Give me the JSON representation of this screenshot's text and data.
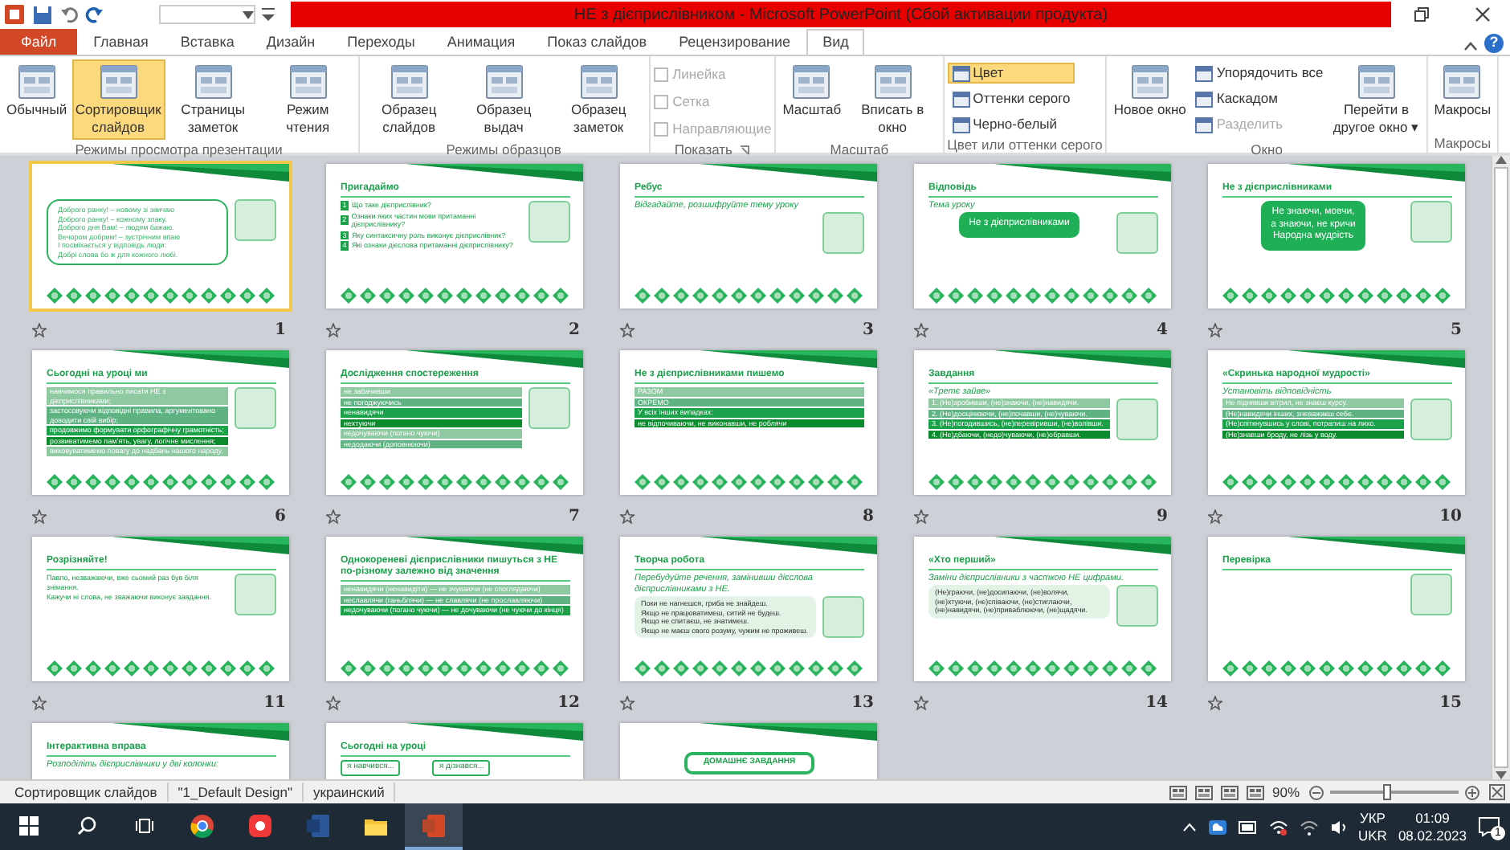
{
  "window": {
    "title": "НЕ з дієприслівником  -  Microsoft PowerPoint (Сбой активации продукта)",
    "help": "?"
  },
  "ribbon_tabs": [
    {
      "label": "Файл",
      "kind": "file",
      "selected": false
    },
    {
      "label": "Главная",
      "kind": "tab",
      "selected": false
    },
    {
      "label": "Вставка",
      "kind": "tab",
      "selected": false
    },
    {
      "label": "Дизайн",
      "kind": "tab",
      "selected": false
    },
    {
      "label": "Переходы",
      "kind": "tab",
      "selected": false
    },
    {
      "label": "Анимация",
      "kind": "tab",
      "selected": false
    },
    {
      "label": "Показ слайдов",
      "kind": "tab",
      "selected": false
    },
    {
      "label": "Рецензирование",
      "kind": "tab",
      "selected": false
    },
    {
      "label": "Вид",
      "kind": "tab",
      "selected": true
    }
  ],
  "ribbon_groups": [
    {
      "label": "Режимы просмотра презентации",
      "controls": [
        {
          "kind": "large",
          "label": "Обычный",
          "selected": false,
          "disabled": false
        },
        {
          "kind": "large",
          "label": "Сортировщик слайдов",
          "selected": true,
          "disabled": false
        },
        {
          "kind": "large",
          "label": "Страницы заметок",
          "selected": false,
          "disabled": false
        },
        {
          "kind": "large",
          "label": "Режим чтения",
          "selected": false,
          "disabled": false
        }
      ]
    },
    {
      "label": "Режимы образцов",
      "controls": [
        {
          "kind": "large",
          "label": "Образец слайдов",
          "selected": false,
          "disabled": false
        },
        {
          "kind": "large",
          "label": "Образец выдач",
          "selected": false,
          "disabled": false
        },
        {
          "kind": "large",
          "label": "Образец заметок",
          "selected": false,
          "disabled": false
        }
      ]
    },
    {
      "label": "Показать",
      "launcher": true,
      "controls": [
        {
          "kind": "check",
          "label": "Линейка",
          "checked": false,
          "disabled": true
        },
        {
          "kind": "check",
          "label": "Сетка",
          "checked": false,
          "disabled": true
        },
        {
          "kind": "check",
          "label": "Направляющие",
          "checked": false,
          "disabled": true
        }
      ]
    },
    {
      "label": "Масштаб",
      "controls": [
        {
          "kind": "large",
          "label": "Масштаб",
          "selected": false,
          "disabled": false
        },
        {
          "kind": "large",
          "label": "Вписать в окно",
          "selected": false,
          "disabled": false
        }
      ]
    },
    {
      "label": "Цвет или оттенки серого",
      "controls": [
        {
          "kind": "small",
          "label": "Цвет",
          "selected": true,
          "disabled": false
        },
        {
          "kind": "small",
          "label": "Оттенки серого",
          "selected": false,
          "disabled": false
        },
        {
          "kind": "small",
          "label": "Черно-белый",
          "selected": false,
          "disabled": false
        }
      ]
    },
    {
      "label": "Окно",
      "controls": [
        {
          "kind": "large",
          "label": "Новое окно",
          "selected": false,
          "disabled": false
        },
        {
          "kind": "small",
          "label": "Упорядочить все",
          "selected": false,
          "disabled": false
        },
        {
          "kind": "small",
          "label": "Каскадом",
          "selected": false,
          "disabled": false
        },
        {
          "kind": "small",
          "label": "Разделить",
          "selected": false,
          "disabled": true
        },
        {
          "kind": "large",
          "label": "Перейти в другое окно ▾",
          "selected": false,
          "disabled": false
        }
      ]
    },
    {
      "label": "Макросы",
      "controls": [
        {
          "kind": "large",
          "label": "Макросы",
          "selected": false,
          "disabled": false
        }
      ]
    }
  ],
  "slides": [
    {
      "number": "1",
      "selected": true,
      "kind": "outline",
      "picture": true,
      "lines": [
        "Доброго ранку! – новому зі звичаю",
        "Доброго ранку! – кожному злаку.",
        "Доброго дня Вам! – людям бажаю.",
        "Вечором добрим! – зустрічним впаю",
        "І посміхається у відповідь люди:",
        "Добрі слова бо ж для кожного любі."
      ]
    },
    {
      "number": "2",
      "selected": false,
      "title": "Пригадаймо",
      "kind": "numbered",
      "picture": true,
      "lines": [
        {
          "n": "1",
          "text": "Що таке дієприслівник?"
        },
        {
          "n": "2",
          "text": "Ознаки яких частин мови притаманні дієприслівнику?"
        },
        {
          "n": "3",
          "text": "Яку синтаксичну роль виконує дієприслівник?"
        },
        {
          "n": "4",
          "text": "Які ознаки дієслова притаманні дієприслівнику?"
        }
      ]
    },
    {
      "number": "3",
      "selected": false,
      "title": "Ребус",
      "subtitle": "Відгадайте, розшифруйте тему уроку",
      "kind": "plain",
      "picture": true
    },
    {
      "number": "4",
      "selected": false,
      "title": "Відповідь",
      "subtitle": "Тема уроку",
      "kind": "bubble",
      "picture": true,
      "lines": [
        "Не з дієприслівниками"
      ]
    },
    {
      "number": "5",
      "selected": false,
      "title": "Не з дієприслівниками",
      "kind": "bubble",
      "picture": true,
      "lines": [
        "Не знаючи, мовчи,",
        "а знаючи, не кричи",
        "Народна мудрість"
      ]
    },
    {
      "number": "6",
      "selected": false,
      "title": "Сьогодні на уроці ми",
      "kind": "boxes",
      "picture": true,
      "lines": [
        "навчимося правильно писати НЕ з дієприслівниками;",
        "застосовуючи відповідні правила, аргументовано доводити свій вибір;",
        "продовжимо формувати орфографічну грамотність;",
        "розвиватимемо пам’ять, увагу, логічне мислення;",
        "виховуватимемо повагу до надбань нашого народу."
      ]
    },
    {
      "number": "7",
      "selected": false,
      "title": "Дослідження спостереження",
      "kind": "boxes",
      "picture": true,
      "lines": [
        "не забачивши",
        "не погоджуючись",
        "ненавидячи",
        "нехтуючи",
        "недочуваючи (погано чуючи)",
        "недодаючи (доповнюючи)"
      ]
    },
    {
      "number": "8",
      "selected": false,
      "title": "Не з дієприслівниками пишемо",
      "kind": "boxes",
      "lines": [
        "РАЗОМ",
        "ОКРЕМО",
        "У всіх інших випадках:",
        "не відпочиваючи, не виконавши, не роблячи"
      ]
    },
    {
      "number": "9",
      "selected": false,
      "title": "Завдання",
      "subtitle": "«Третє зайве»",
      "kind": "boxes",
      "picture": true,
      "lines": [
        "1. (Не)зробивши, (не)знаючи, (не)навидячи.",
        "2. (Не)дооцінюючи, (не)почавши, (не)чуваючи.",
        "3. (Не)погодившись, (не)перевіривши, (не)волівши.",
        "4. (Не)дбаючи, (недо)чуваючи, (не)обравши."
      ]
    },
    {
      "number": "10",
      "selected": false,
      "title": "«Скринька народної мудрості»",
      "subtitle": "Установіть відповідність",
      "kind": "boxes",
      "picture": true,
      "lines": [
        "Не піднявши вітрил, не знаєш курсу.",
        "(Не)навидячи інших, зневажаєш себе.",
        "(Не)спіткнувшись у слові, потрапиш на лихо.",
        "(Не)знавши броду, не лізь у воду."
      ]
    },
    {
      "number": "11",
      "selected": false,
      "title": "Розрізняйте!",
      "kind": "plain",
      "picture": true,
      "lines": [
        "Павло, незважаючи, вже сьомий раз був біля знімання.",
        "Кажучи ні слова, не зважаючи виконує завдання."
      ]
    },
    {
      "number": "12",
      "selected": false,
      "title": "Однокореневі дієприслівники пишуться з НЕ по-різному залежно від значення",
      "kind": "boxes",
      "lines": [
        "ненавидячи (ненавидіти) — не зчуваючи (не споглядаючи)",
        "неславлячи (ганьблячи) — не славлячи (не прославляючи)",
        "недочуваючи (погано чуючи) — не дочуваючи (не чуючи до кінця)"
      ]
    },
    {
      "number": "13",
      "selected": false,
      "title": "Творча робота",
      "subtitle": "Перебудуйте речення, замінивши дієслова дієприслівниками з НЕ.",
      "kind": "light",
      "picture": true,
      "lines": [
        "Поки не нагнешся, гриба не знайдеш.",
        "Якщо не працюватимеш, ситий не будеш.",
        "Якщо не спитаєш, не знатимеш.",
        "Якщо не маєш свого розуму, чужим не проживеш."
      ]
    },
    {
      "number": "14",
      "selected": false,
      "title": "«Хто перший»",
      "subtitle": "Заміни дієприслівники з часткою НЕ цифрами.",
      "kind": "light",
      "picture": true,
      "lines": [
        "(Не)граючи, (не)досипаючи, (не)волячи,",
        "(не)хтуючи, (не)співаючи, (не)стиглаючи,",
        "(не)навидячи, (не)приваблюючи, (не)щадячи."
      ]
    },
    {
      "number": "15",
      "selected": false,
      "title": "Перевірка",
      "kind": "plain",
      "picture": true
    },
    {
      "selected": false,
      "title": "Інтерактивна вправа",
      "subtitle": "Розподіліть дієприслівники у дві колонки:",
      "kind": "plain"
    },
    {
      "selected": false,
      "title": "Сьогодні на уроці",
      "kind": "callouts",
      "lines": [
        "я навчився...",
        "я дізнався..."
      ]
    },
    {
      "selected": false,
      "kind": "banner",
      "lines": [
        "ДОМАШНЄ ЗАВДАННЯ"
      ]
    }
  ],
  "status_bar": {
    "view": "Сортировщик слайдов",
    "theme": "\"1_Default Design\"",
    "language": "украинский",
    "zoom": "90%",
    "zoom_slider": {
      "level": 0.45
    }
  },
  "taskbar": {
    "apps": [
      {
        "kind": "browser",
        "selected": false
      },
      {
        "kind": "vivaldi",
        "selected": false
      },
      {
        "kind": "word",
        "selected": false
      },
      {
        "kind": "folder",
        "selected": false
      },
      {
        "kind": "powerpoint",
        "selected": true
      }
    ],
    "language": [
      "УКР",
      "UKR"
    ],
    "time": "01:09",
    "date": "08.02.2023",
    "notifications": "1"
  }
}
